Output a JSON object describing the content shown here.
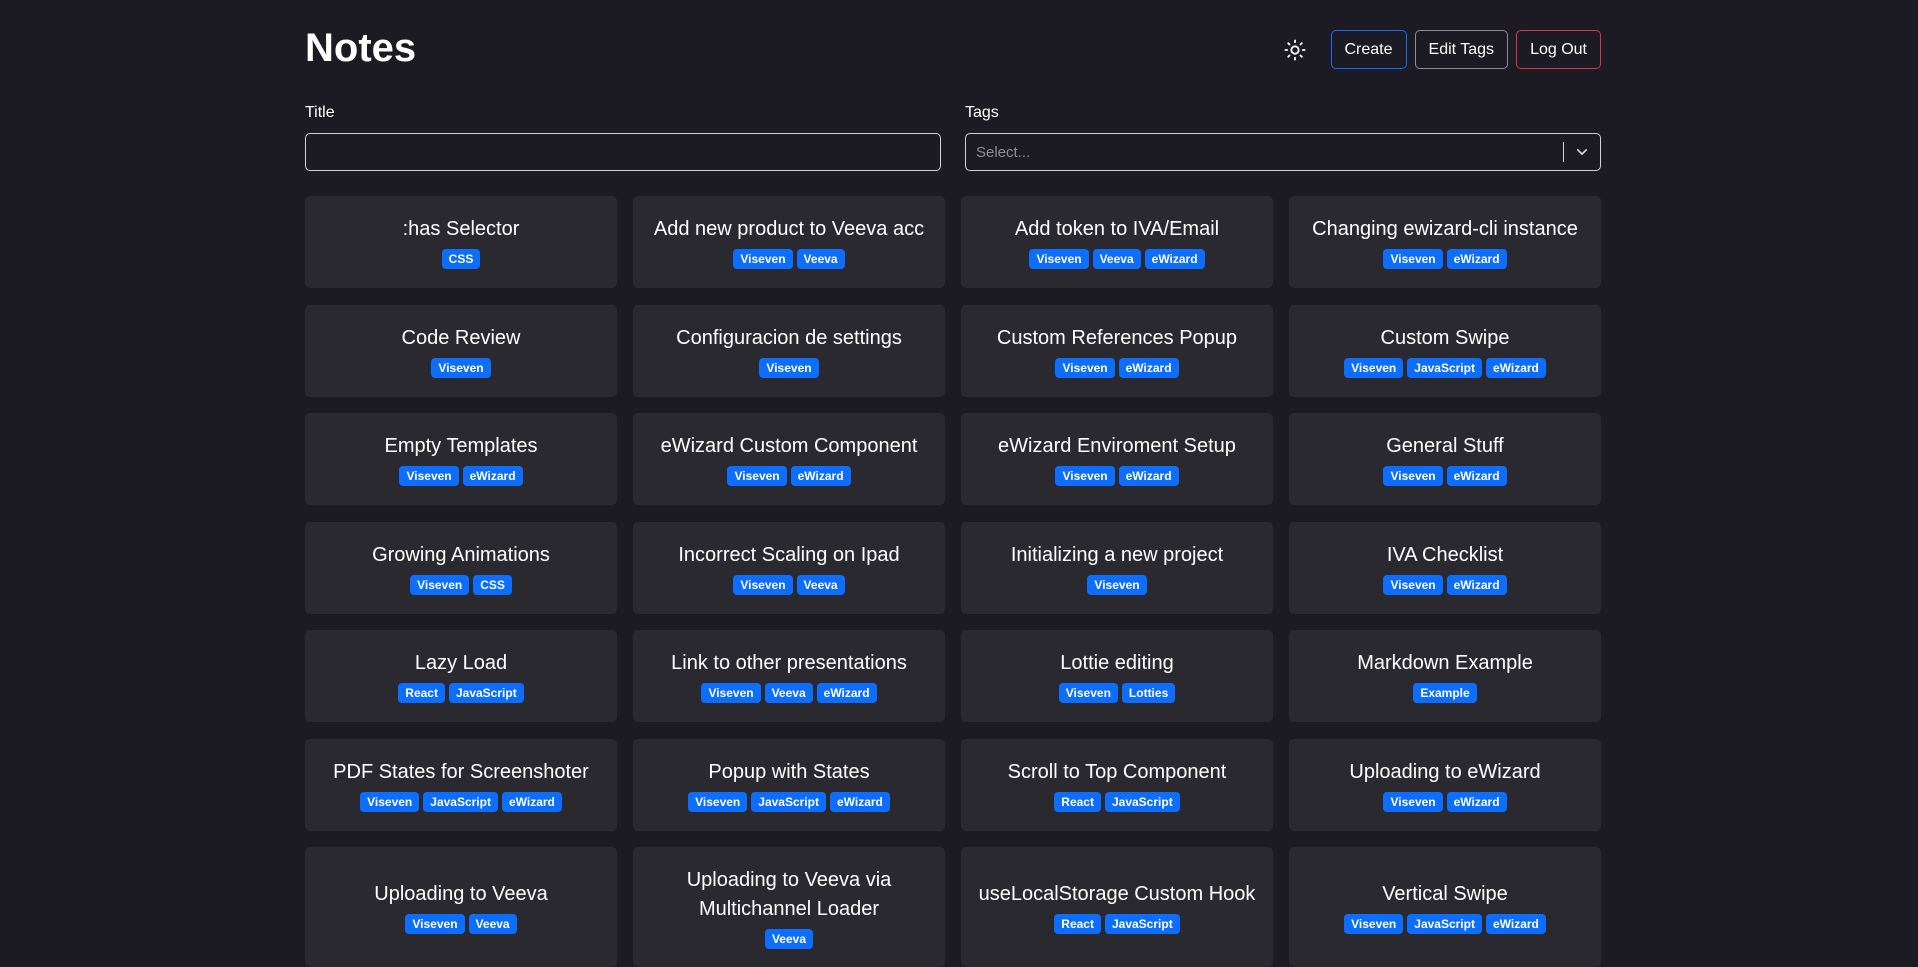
{
  "header": {
    "title": "Notes",
    "theme_icon": "sun-icon",
    "create_label": "Create",
    "edit_tags_label": "Edit Tags",
    "logout_label": "Log Out"
  },
  "filters": {
    "title_label": "Title",
    "title_value": "",
    "tags_label": "Tags",
    "tags_placeholder": "Select..."
  },
  "colors": {
    "background": "#1c1a22",
    "card": "#2a2930",
    "tag": "#0d6efd",
    "primary": "#0d6efd",
    "danger": "#dc3545"
  },
  "notes": [
    {
      "title": ":has Selector",
      "tags": [
        "CSS"
      ]
    },
    {
      "title": "Add new product to Veeva acc",
      "tags": [
        "Viseven",
        "Veeva"
      ]
    },
    {
      "title": "Add token to IVA/Email",
      "tags": [
        "Viseven",
        "Veeva",
        "eWizard"
      ]
    },
    {
      "title": "Changing ewizard-cli instance",
      "tags": [
        "Viseven",
        "eWizard"
      ]
    },
    {
      "title": "Code Review",
      "tags": [
        "Viseven"
      ]
    },
    {
      "title": "Configuracion de settings",
      "tags": [
        "Viseven"
      ]
    },
    {
      "title": "Custom References Popup",
      "tags": [
        "Viseven",
        "eWizard"
      ]
    },
    {
      "title": "Custom Swipe",
      "tags": [
        "Viseven",
        "JavaScript",
        "eWizard"
      ]
    },
    {
      "title": "Empty Templates",
      "tags": [
        "Viseven",
        "eWizard"
      ]
    },
    {
      "title": "eWizard Custom Component",
      "tags": [
        "Viseven",
        "eWizard"
      ]
    },
    {
      "title": "eWizard Enviroment Setup",
      "tags": [
        "Viseven",
        "eWizard"
      ]
    },
    {
      "title": "General Stuff",
      "tags": [
        "Viseven",
        "eWizard"
      ]
    },
    {
      "title": "Growing Animations",
      "tags": [
        "Viseven",
        "CSS"
      ]
    },
    {
      "title": "Incorrect Scaling on Ipad",
      "tags": [
        "Viseven",
        "Veeva"
      ]
    },
    {
      "title": "Initializing a new project",
      "tags": [
        "Viseven"
      ]
    },
    {
      "title": "IVA Checklist",
      "tags": [
        "Viseven",
        "eWizard"
      ]
    },
    {
      "title": "Lazy Load",
      "tags": [
        "React",
        "JavaScript"
      ]
    },
    {
      "title": "Link to other presentations",
      "tags": [
        "Viseven",
        "Veeva",
        "eWizard"
      ]
    },
    {
      "title": "Lottie editing",
      "tags": [
        "Viseven",
        "Lotties"
      ]
    },
    {
      "title": "Markdown Example",
      "tags": [
        "Example"
      ]
    },
    {
      "title": "PDF States for Screenshoter",
      "tags": [
        "Viseven",
        "JavaScript",
        "eWizard"
      ]
    },
    {
      "title": "Popup with States",
      "tags": [
        "Viseven",
        "JavaScript",
        "eWizard"
      ]
    },
    {
      "title": "Scroll to Top Component",
      "tags": [
        "React",
        "JavaScript"
      ]
    },
    {
      "title": "Uploading to eWizard",
      "tags": [
        "Viseven",
        "eWizard"
      ]
    },
    {
      "title": "Uploading to Veeva",
      "tags": [
        "Viseven",
        "Veeva"
      ]
    },
    {
      "title": "Uploading to Veeva via Multichannel Loader",
      "tags": [
        "Veeva"
      ]
    },
    {
      "title": "useLocalStorage Custom Hook",
      "tags": [
        "React",
        "JavaScript"
      ]
    },
    {
      "title": "Vertical Swipe",
      "tags": [
        "Viseven",
        "JavaScript",
        "eWizard"
      ]
    }
  ]
}
